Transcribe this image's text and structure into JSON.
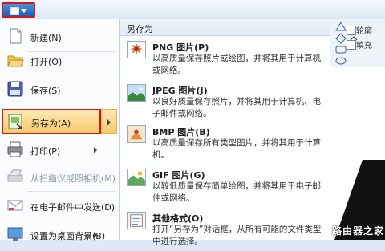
{
  "left_menu": {
    "items": [
      {
        "label": "新建(N)",
        "icon": "new-doc-icon"
      },
      {
        "label": "打开(O)",
        "icon": "open-folder-icon"
      },
      {
        "label": "保存(S)",
        "icon": "save-disk-icon"
      },
      {
        "label": "另存为(A)",
        "icon": "save-as-icon"
      },
      {
        "label": "打印(P)",
        "icon": "printer-icon"
      },
      {
        "label": "从扫描仪或照相机(M)",
        "icon": "scanner-icon"
      },
      {
        "label": "在电子邮件中发送(D)",
        "icon": "email-icon"
      },
      {
        "label": "设置为桌面背景(B)",
        "icon": "desktop-background-icon"
      }
    ]
  },
  "submenu": {
    "header": "另存为",
    "items": [
      {
        "title": "PNG 图片(P)",
        "desc": "以高质量保存照片或绘图，并将其用于计算机或网络。",
        "icon": "png-image-icon"
      },
      {
        "title": "JPEG 图片(J)",
        "desc": "以良好质量保存照片，并将其用于计算机、电子邮件或网络。",
        "icon": "jpeg-image-icon"
      },
      {
        "title": "BMP 图片(B)",
        "desc": "以高质量保存所有类型图片，并将其用于计算机。",
        "icon": "bmp-image-icon"
      },
      {
        "title": "GIF 图片(G)",
        "desc": "以较低质量保存简单绘图，并将其用于电子邮件或网络。",
        "icon": "gif-image-icon"
      },
      {
        "title": "其他格式(O)",
        "desc": "打开“另存为”对话框，从所有可能的文件类型中进行选择。",
        "icon": "other-formats-icon"
      }
    ]
  },
  "ribbon": {
    "outline_label": "轮廓",
    "fill_label": "填充"
  },
  "watermark": "路由器之家"
}
